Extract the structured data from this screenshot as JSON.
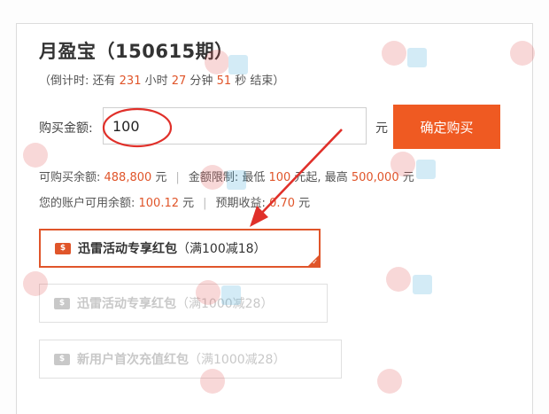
{
  "header": {
    "product": "月盈宝",
    "issue": "（150615期）",
    "countdown_prefix": "（倒计时: 还有 ",
    "hours": "231",
    "hours_unit": " 小时 ",
    "minutes": "27",
    "minutes_unit": " 分钟 ",
    "seconds": "51",
    "seconds_unit": " 秒 结束）"
  },
  "purchase": {
    "label": "购买金额:",
    "value": "100",
    "unit": "元",
    "button": "确定购买"
  },
  "info": {
    "available_label": "可购买余额: ",
    "available_value": "488,800",
    "available_unit": " 元",
    "limit_label": "金额限制: 最低 ",
    "limit_min": "100",
    "limit_mid": " 元起, 最高 ",
    "limit_max": "500,000",
    "limit_unit": " 元",
    "balance_label": "您的账户可用余额: ",
    "balance_value": "100.12",
    "balance_unit": " 元",
    "expected_label": "预期收益: ",
    "expected_value": "0.70",
    "expected_unit": " 元"
  },
  "coupons": [
    {
      "name": "迅雷活动专享红包",
      "condition": "（满100减18）",
      "state": "selected"
    },
    {
      "name": "迅雷活动专享红包",
      "condition": "（满1000减28）",
      "state": "disabled"
    },
    {
      "name": "新用户首次充值红包",
      "condition": "（满1000减28）",
      "state": "disabled"
    }
  ],
  "colors": {
    "accent": "#ef5a22",
    "highlight": "#e0552a",
    "annotation": "#e0302a"
  },
  "icons": {
    "coupon": "coin-icon",
    "selected": "check-corner-icon"
  }
}
